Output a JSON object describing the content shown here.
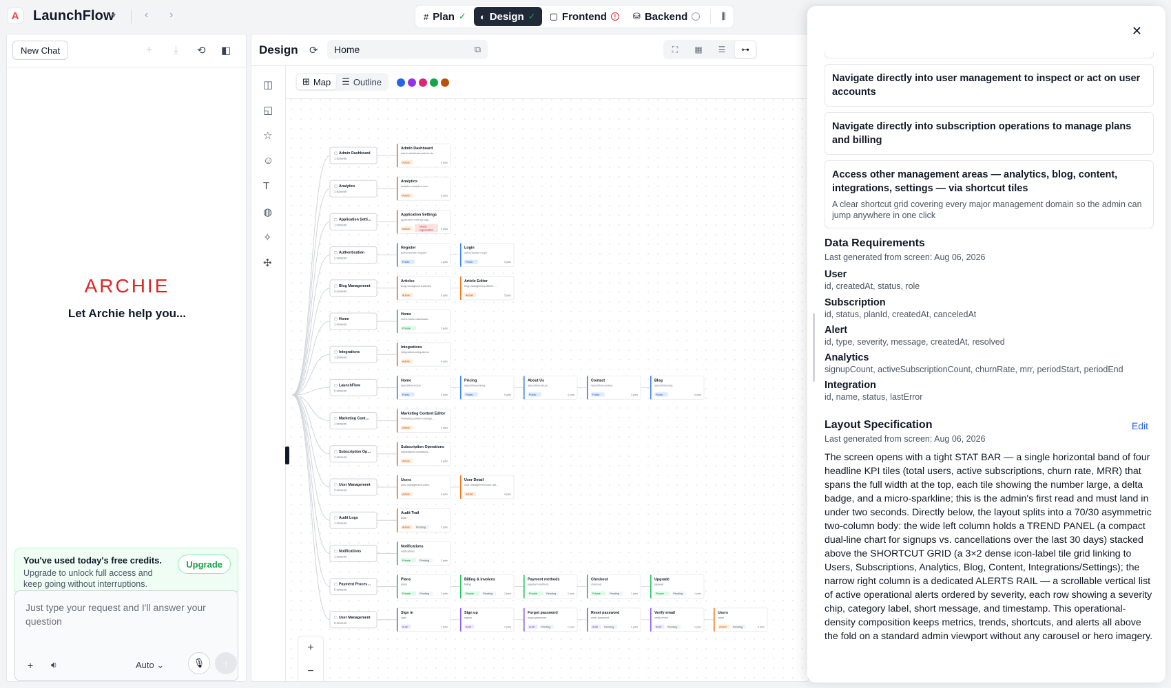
{
  "app": {
    "name": "LaunchFlow",
    "logo_letter": "A"
  },
  "tabs": [
    {
      "label": "Plan",
      "icon": "hash-icon",
      "status": "done"
    },
    {
      "label": "Design",
      "icon": "palette-icon",
      "status": "done",
      "active": true
    },
    {
      "label": "Frontend",
      "icon": "code-icon",
      "status": "error"
    },
    {
      "label": "Backend",
      "icon": "database-icon",
      "status": "pending"
    }
  ],
  "chat": {
    "new_chat": "New Chat",
    "brand": "ARCHIE",
    "tagline": "Let Archie help you...",
    "credits_title": "You've used today's free credits.",
    "credits_body": "Upgrade to unlock full access and keep going without interruptions.",
    "upgrade": "Upgrade",
    "input_placeholder": "Just type your request and I'll answer your question",
    "mode": "Auto"
  },
  "design": {
    "title": "Design",
    "url": "Home",
    "view_map": "Map",
    "view_outline": "Outline",
    "palette": [
      "#2563eb",
      "#9333ea",
      "#db2777",
      "#16a34a",
      "#b45309"
    ]
  },
  "map": {
    "groups": [
      {
        "name": "Admin Dashboard",
        "count": "1 screens",
        "screens": [
          {
            "name": "Admin Dashboard",
            "slug": "admin-dashboard-admin-da…",
            "badge": "Admin",
            "jobs": "5 jobs"
          }
        ]
      },
      {
        "name": "Analytics",
        "count": "1 screens",
        "screens": [
          {
            "name": "Analytics",
            "slug": "analytics-analytics-over…",
            "badge": "Admin",
            "jobs": "5 jobs"
          }
        ]
      },
      {
        "name": "Application Setti…",
        "count": "1 screens",
        "screens": [
          {
            "name": "Application Settings",
            "slug": "application-settings-app…",
            "badge": "Admin",
            "extra": "Needs regeneration",
            "jobs": "4 jobs"
          }
        ]
      },
      {
        "name": "Authentication",
        "count": "2 screens",
        "screens": [
          {
            "name": "Register",
            "slug": "authentication-register",
            "badge": "Public",
            "jobs": "3 jobs"
          },
          {
            "name": "Login",
            "slug": "authentication-login",
            "badge": "Public",
            "jobs": "3 jobs"
          }
        ]
      },
      {
        "name": "Blog Management",
        "count": "2 screens",
        "screens": [
          {
            "name": "Articles",
            "slug": "blog-management-articles",
            "badge": "Admin",
            "jobs": "5 jobs"
          },
          {
            "name": "Article Editor",
            "slug": "blog-management-article-…",
            "badge": "Admin",
            "jobs": "5 jobs"
          }
        ]
      },
      {
        "name": "Home",
        "count": "1 screens",
        "screens": [
          {
            "name": "Home",
            "slug": "home-home-dashboard",
            "badge": "Private",
            "jobs": "5 jobs"
          }
        ]
      },
      {
        "name": "Integrations",
        "count": "1 screens",
        "screens": [
          {
            "name": "Integrations",
            "slug": "integrations-integrations",
            "badge": "Admin",
            "jobs": "4 jobs"
          }
        ]
      },
      {
        "name": "LaunchFlow",
        "count": "5 screens",
        "screens": [
          {
            "name": "Home",
            "slug": "launchflow-home",
            "badge": "Public",
            "jobs": "5 jobs"
          },
          {
            "name": "Pricing",
            "slug": "launchflow-pricing",
            "badge": "Public",
            "jobs": "5 jobs"
          },
          {
            "name": "About Us",
            "slug": "launchflow-about",
            "badge": "Public",
            "jobs": "4 jobs"
          },
          {
            "name": "Contact",
            "slug": "launchflow-contact",
            "badge": "Public",
            "jobs": "3 jobs"
          },
          {
            "name": "Blog",
            "slug": "launchflow-blog",
            "badge": "Public",
            "jobs": "4 jobs"
          }
        ]
      },
      {
        "name": "Marketing Cont…",
        "count": "1 screens",
        "screens": [
          {
            "name": "Marketing Content Editor",
            "slug": "marketing-content-manage…",
            "badge": "Admin",
            "jobs": "4 jobs"
          }
        ]
      },
      {
        "name": "Subscription Op…",
        "count": "1 screens",
        "screens": [
          {
            "name": "Subscription Operations",
            "slug": "subscription-operations-…",
            "badge": "Admin",
            "jobs": "4 jobs"
          }
        ]
      },
      {
        "name": "User Management",
        "count": "2 screens",
        "screens": [
          {
            "name": "Users",
            "slug": "user-management-users",
            "badge": "Admin",
            "jobs": "4 jobs"
          },
          {
            "name": "User Detail",
            "slug": "user-management-user-det…",
            "badge": "Admin",
            "jobs": "4 jobs"
          }
        ]
      },
      {
        "name": "Audit Logs",
        "count": "1 screens",
        "screens": [
          {
            "name": "Audit Trail",
            "slug": "audit",
            "badge": "Admin",
            "extra": "Pending",
            "jobs": "2 jobs"
          }
        ]
      },
      {
        "name": "Notifications",
        "count": "1 screens",
        "screens": [
          {
            "name": "Notifications",
            "slug": "notifications",
            "badge": "Private",
            "extra": "Pending",
            "jobs": "2 jobs"
          }
        ]
      },
      {
        "name": "Payment Proces…",
        "count": "5 screens",
        "screens": [
          {
            "name": "Plans",
            "slug": "plans",
            "badge": "Private",
            "extra": "Pending",
            "jobs": "2 jobs"
          },
          {
            "name": "Billing & invoices",
            "slug": "billing",
            "badge": "Private",
            "extra": "Pending",
            "jobs": "2 jobs"
          },
          {
            "name": "Payment methods",
            "slug": "payment-methods",
            "badge": "Private",
            "extra": "Pending",
            "jobs": "2 jobs"
          },
          {
            "name": "Checkout",
            "slug": "checkout",
            "badge": "Private",
            "extra": "Pending",
            "jobs": "1 jobs"
          },
          {
            "name": "Upgrade",
            "slug": "paywall",
            "badge": "Private",
            "extra": "Pending",
            "jobs": "1 jobs"
          }
        ]
      },
      {
        "name": "User Management",
        "count": "6 screens",
        "screens": [
          {
            "name": "Sign in",
            "slug": "login",
            "badge": "Auth",
            "jobs": "1 jobs"
          },
          {
            "name": "Sign up",
            "slug": "signup",
            "badge": "Auth",
            "jobs": "1 jobs"
          },
          {
            "name": "Forgot password",
            "slug": "forgot-password",
            "badge": "Auth",
            "extra": "Pending",
            "jobs": "1 jobs"
          },
          {
            "name": "Reset password",
            "slug": "reset-password",
            "badge": "Auth",
            "extra": "Pending",
            "jobs": "1 jobs"
          },
          {
            "name": "Verify email",
            "slug": "verify-email",
            "badge": "Auth",
            "extra": "Pending",
            "jobs": "1 jobs"
          },
          {
            "name": "Users",
            "slug": "users",
            "badge": "Admin",
            "extra": "Pending",
            "jobs": "2 jobs"
          }
        ]
      }
    ]
  },
  "spec": {
    "cards": [
      {
        "title": "Navigate directly into user management to inspect or act on user accounts"
      },
      {
        "title": "Navigate directly into subscription operations to manage plans and billing"
      },
      {
        "title": "Access other management areas — analytics, blog, content, integrations, settings — via shortcut tiles",
        "desc": "A clear shortcut grid covering every major management domain so the admin can jump anywhere in one click"
      }
    ],
    "data_title": "Data Requirements",
    "data_sub": "Last generated from screen: Aug 06, 2026",
    "entities": [
      {
        "name": "User",
        "fields": "id, createdAt, status, role"
      },
      {
        "name": "Subscription",
        "fields": "id, status, planId, createdAt, canceledAt"
      },
      {
        "name": "Alert",
        "fields": "id, type, severity, message, createdAt, resolved"
      },
      {
        "name": "Analytics",
        "fields": "signupCount, activeSubscriptionCount, churnRate, mrr, periodStart, periodEnd"
      },
      {
        "name": "Integration",
        "fields": "id, name, status, lastError"
      }
    ],
    "layout_title": "Layout Specification",
    "layout_sub": "Last generated from screen: Aug 06, 2026",
    "edit": "Edit",
    "layout_text": "The screen opens with a tight STAT BAR — a single horizontal band of four headline KPI tiles (total users, active subscriptions, churn rate, MRR) that spans the full width at the top, each tile showing the number large, a delta badge, and a micro-sparkline; this is the admin's first read and must land in under two seconds. Directly below, the layout splits into a 70/30 asymmetric two-column body: the wide left column holds a TREND PANEL (a compact dual-line chart for signups vs. cancellations over the last 30 days) stacked above the SHORTCUT GRID (a 3×2 dense icon-label tile grid linking to Users, Subscriptions, Analytics, Blog, Content, Integrations/Settings); the narrow right column is a dedicated ALERTS RAIL — a scrollable vertical list of active operational alerts ordered by severity, each row showing a severity chip, category label, short message, and timestamp. This operational-density composition keeps metrics, trends, shortcuts, and alerts all above the fold on a standard admin viewport without any carousel or hero imagery."
  }
}
